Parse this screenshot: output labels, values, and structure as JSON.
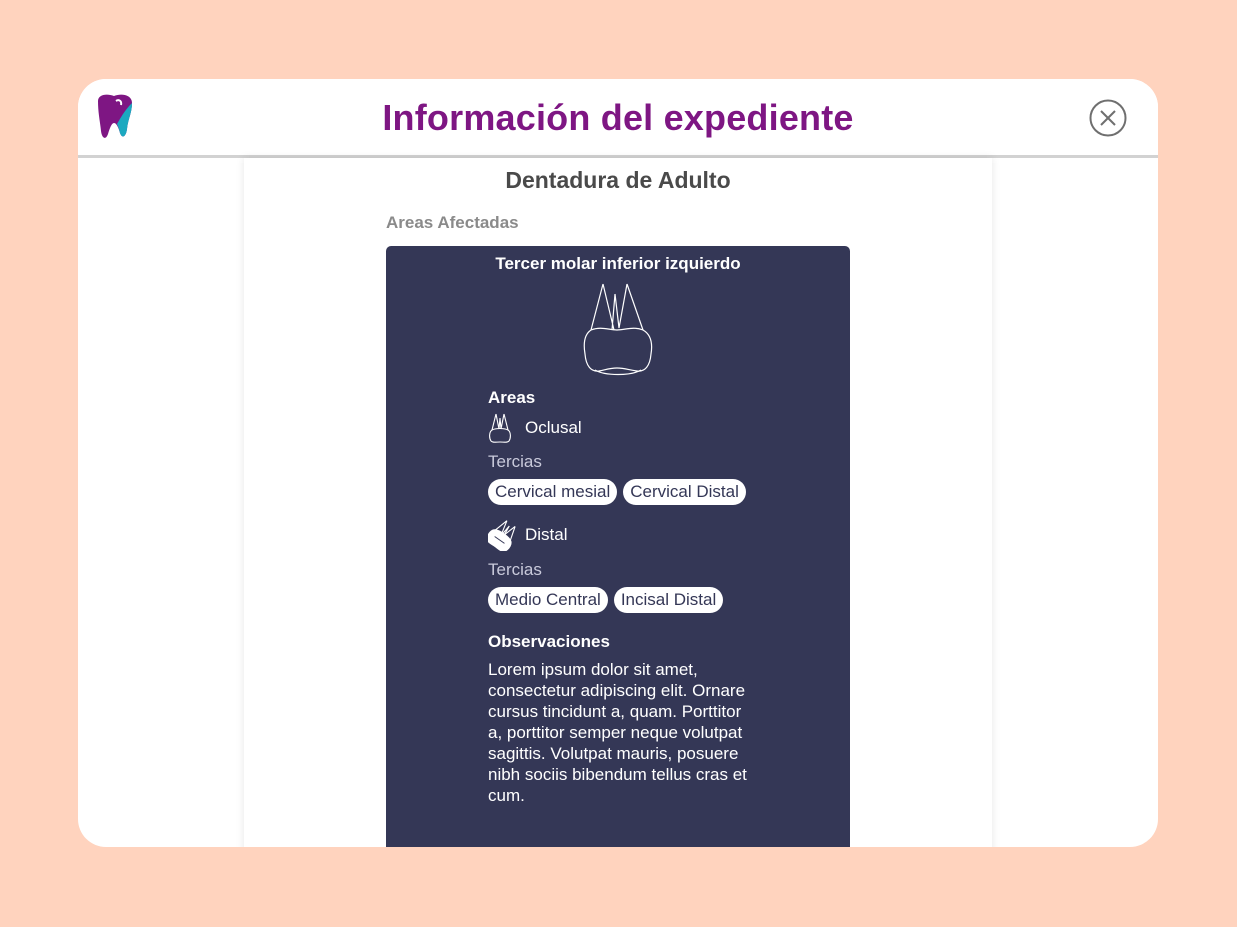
{
  "modal": {
    "title": "Información del expediente",
    "close_icon": "close-circle-icon",
    "logo_icon": "tooth-logo-icon"
  },
  "sheet": {
    "title": "Dentadura de Adulto",
    "section_label": "Areas Afectadas"
  },
  "card": {
    "tooth_name": "Tercer molar inferior izquierdo",
    "areas_heading": "Areas",
    "areas": [
      {
        "name": "Oclusal",
        "icon": "tooth-oclusal-icon",
        "tercias_label": "Tercias",
        "tercias": [
          "Cervical mesial",
          "Cervical Distal"
        ]
      },
      {
        "name": "Distal",
        "icon": "tooth-distal-icon",
        "tercias_label": "Tercias",
        "tercias": [
          "Medio Central",
          "Incisal Distal"
        ]
      }
    ],
    "observations_heading": "Observaciones",
    "observations": "Lorem ipsum dolor sit amet, consectetur adipiscing elit. Ornare cursus tincidunt a, quam. Porttitor a, porttitor semper neque volutpat sagittis. Volutpat mauris, posuere nibh sociis bibendum tellus cras et cum."
  },
  "colors": {
    "background": "#FFD3BE",
    "accent": "#7E1683",
    "card": "#343756",
    "logo_secondary": "#1BA9C0"
  }
}
